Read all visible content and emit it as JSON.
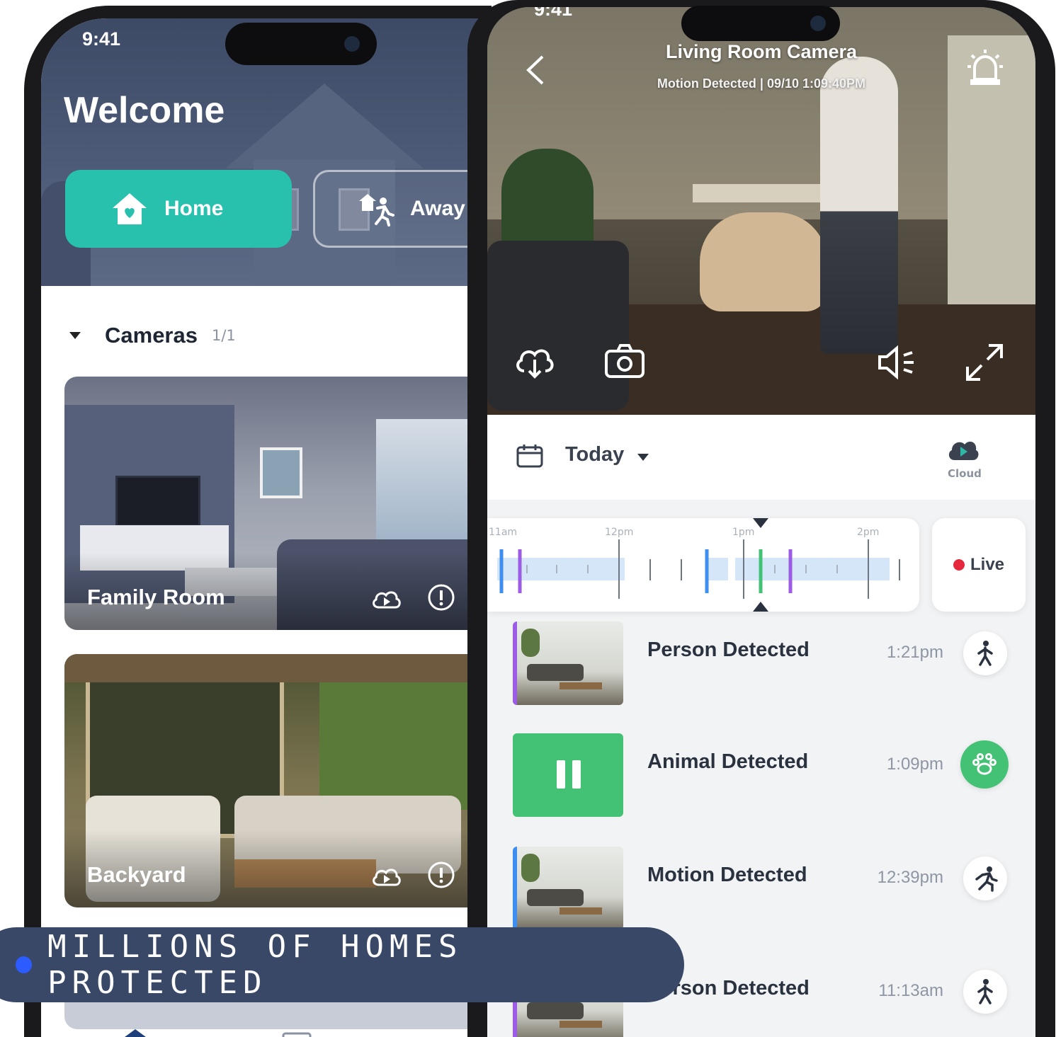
{
  "left_phone": {
    "status_time": "9:41",
    "welcome": "Welcome",
    "modes": {
      "home_label": "Home",
      "away_label": "Away"
    },
    "cameras_section": {
      "label": "Cameras",
      "count": "1/1"
    },
    "camera_cards": [
      {
        "name": "Family Room"
      },
      {
        "name": "Backyard"
      }
    ]
  },
  "right_phone": {
    "status_time": "9:41",
    "camera_title": "Living Room Camera",
    "camera_subtitle": "Motion Detected | 09/10 1:09:40PM",
    "date_filter": "Today",
    "cloud_label": "Cloud",
    "timeline_labels": [
      "11am",
      "12pm",
      "1pm",
      "2pm"
    ],
    "live_label": "Live",
    "events": [
      {
        "title": "Person Detected",
        "time": "1:21pm",
        "icon": "person-walk-icon",
        "stripe": "#9c5ce6"
      },
      {
        "title": "Animal Detected",
        "time": "1:09pm",
        "icon": "paw-icon",
        "stripe": "#43c175"
      },
      {
        "title": "Motion Detected",
        "time": "12:39pm",
        "icon": "running-icon",
        "stripe": "#3d8ef0"
      },
      {
        "title": "Person Detected",
        "time": "11:13am",
        "icon": "person-walk-icon",
        "stripe": "#9c5ce6"
      }
    ]
  },
  "banner": {
    "text": "MILLIONS OF HOMES PROTECTED"
  },
  "colors": {
    "accent_teal": "#27c1ad",
    "animal_green": "#43c175",
    "live_red": "#e5283b",
    "banner_bg": "#394866",
    "banner_dot": "#2c5bff"
  }
}
